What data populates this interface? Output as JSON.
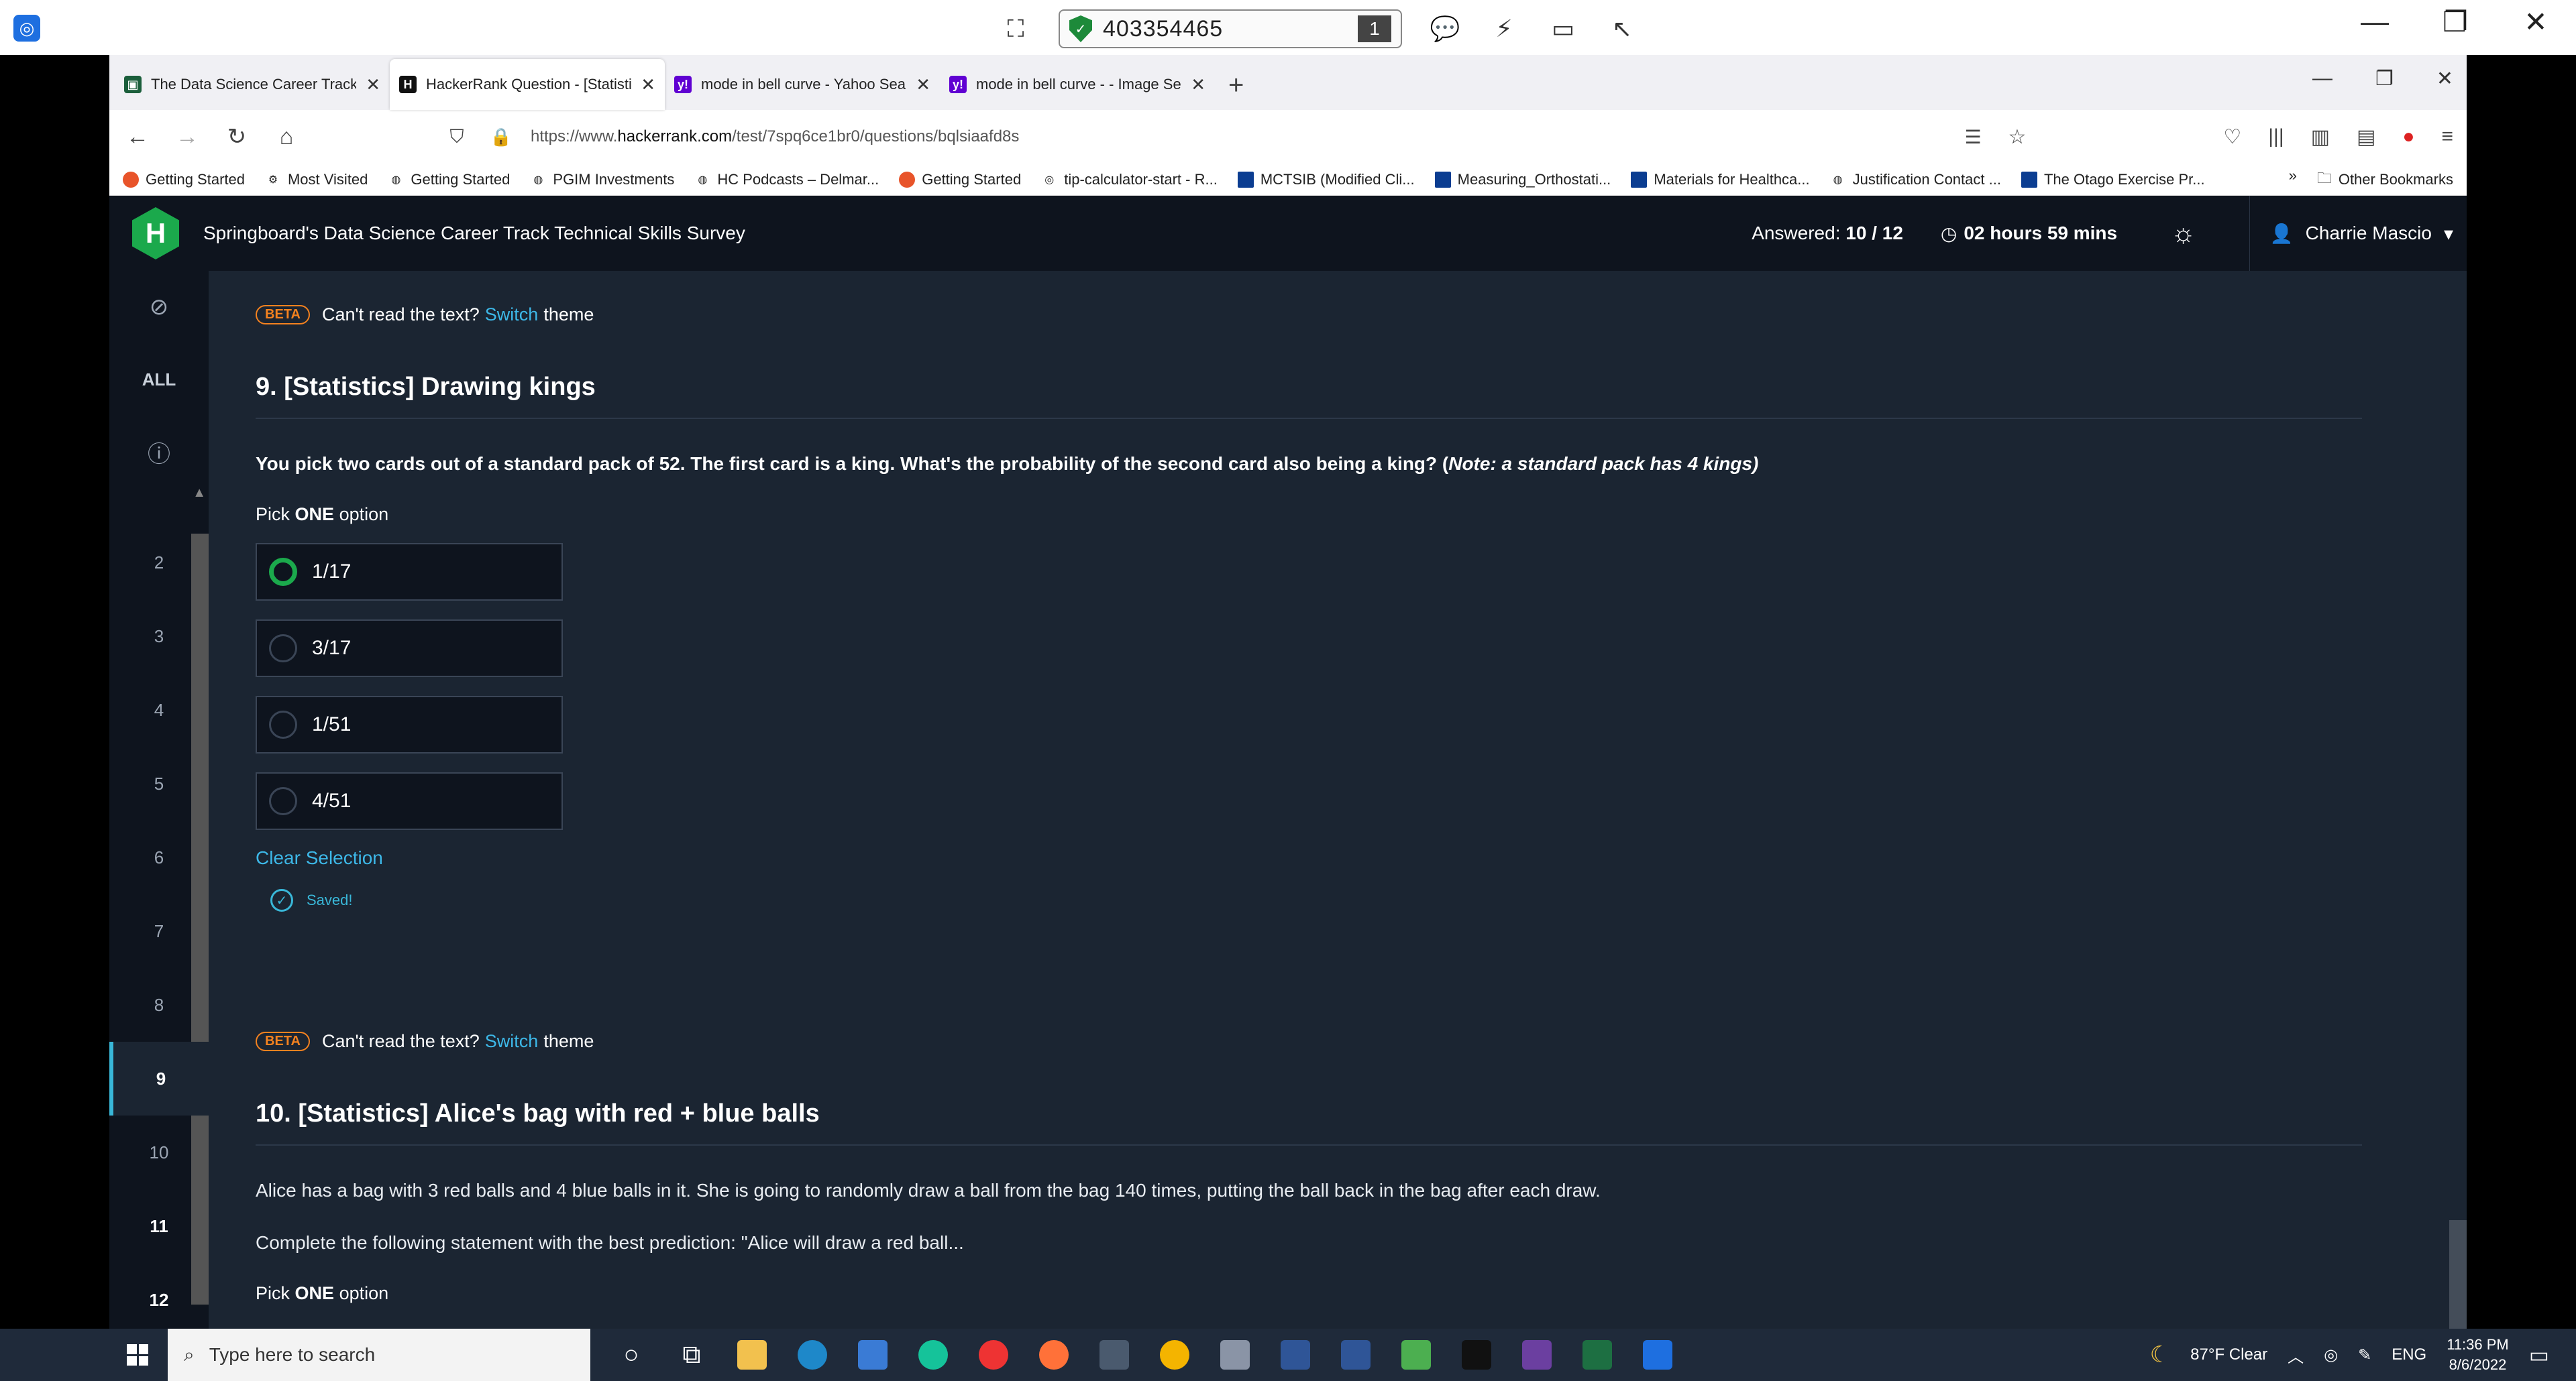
{
  "remote": {
    "session_id": "403354465",
    "monitor_count": "1"
  },
  "browser": {
    "tabs": [
      {
        "title": "The Data Science Career Track T",
        "color": "#1b5e3b",
        "active": false
      },
      {
        "title": "HackerRank Question - [Statisti",
        "color": "#111111",
        "active": true
      },
      {
        "title": "mode in bell curve - Yahoo Sea",
        "color": "#6001d2",
        "active": false
      },
      {
        "title": "mode in bell curve - - Image Se",
        "color": "#6001d2",
        "active": false
      }
    ],
    "url_prefix": "https://www.",
    "url_domain": "hackerrank.com",
    "url_path": "/test/7spq6ce1br0/questions/bqlsiaafd8s",
    "bookmarks": [
      {
        "label": "Getting Started",
        "color": "#e8542a"
      },
      {
        "label": "Most Visited",
        "color": "#666666"
      },
      {
        "label": "Getting Started",
        "color": "#666666"
      },
      {
        "label": "PGIM Investments",
        "color": "#333333"
      },
      {
        "label": "HC Podcasts – Delmar...",
        "color": "#666666"
      },
      {
        "label": "Getting Started",
        "color": "#e8542a"
      },
      {
        "label": "tip-calculator-start - R...",
        "color": "#333333"
      },
      {
        "label": "MCTSIB (Modified Cli...",
        "color": "#0b3d91"
      },
      {
        "label": "Measuring_Orthostati...",
        "color": "#0b3d91"
      },
      {
        "label": "Materials for Healthca...",
        "color": "#0b3d91"
      },
      {
        "label": "Justification Contact ...",
        "color": "#666666"
      },
      {
        "label": "The Otago Exercise Pr...",
        "color": "#0b3d91"
      }
    ],
    "other_bookmarks": "Other Bookmarks"
  },
  "hackerrank": {
    "logo": "H",
    "test_title": "Springboard's Data Science Career Track Technical Skills Survey",
    "answered_label": "Answered:",
    "answered_value": "10 / 12",
    "timer": "02 hours 59 mins",
    "user": "Charrie Mascio",
    "sidebar_all": "ALL",
    "question_numbers": [
      "2",
      "3",
      "4",
      "5",
      "6",
      "7",
      "8",
      "9",
      "10",
      "11",
      "12"
    ],
    "current_question": "9"
  },
  "beta_bar": {
    "badge": "BETA",
    "text": "Can't read the text?",
    "link": "Switch",
    "suffix": "theme"
  },
  "q9": {
    "title": "9. [Statistics] Drawing kings",
    "text": "You pick two cards out of a standard pack of 52. The first card is a king. What's the probability of the second card also being a king? (",
    "note": "Note: a standard pack has 4 kings)",
    "pick_prefix": "Pick",
    "pick_bold": "ONE",
    "pick_suffix": "option",
    "options": [
      "1/17",
      "3/17",
      "1/51",
      "4/51"
    ],
    "selected_index": 0,
    "clear": "Clear Selection",
    "saved": "Saved!"
  },
  "q10": {
    "title": "10. [Statistics] Alice's bag with red + blue balls",
    "text1": "Alice has a bag with 3 red balls and 4 blue balls in it. She is going to randomly draw a ball from the bag 140 times, putting the ball back in the bag after each draw.",
    "text2": "Complete the following statement with the best prediction: \"Alice will draw a red ball...",
    "pick_prefix": "Pick",
    "pick_bold": "ONE",
    "pick_suffix": "option"
  },
  "taskbar": {
    "search_placeholder": "Type here to search",
    "weather": "87°F  Clear",
    "lang": "ENG",
    "time": "11:36 PM",
    "date": "8/6/2022"
  }
}
